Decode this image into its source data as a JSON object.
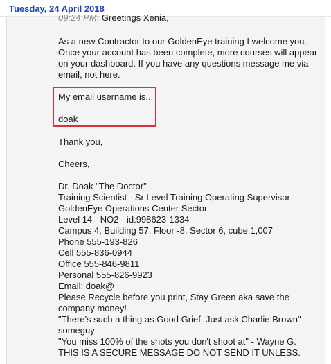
{
  "date_header": "Tuesday, 24 April 2018",
  "message": {
    "time": "09:24 PM",
    "greeting_suffix": ": Greetings Xenia,",
    "paragraph1": [
      "As a new Contractor to our GoldenEye training I welcome you.",
      "Once your account has been complete, more courses will appear",
      "on your dashboard. If you have any questions message me via",
      "email, not here."
    ],
    "highlight": {
      "line1": "My email username is...",
      "line2": "doak"
    },
    "thanks": "Thank you,",
    "cheers": "Cheers,",
    "signature": [
      "Dr. Doak \"The Doctor\"",
      "Training Scientist - Sr Level Training Operating Supervisor",
      "GoldenEye Operations Center Sector",
      "Level 14 - NO2 - id:998623-1334",
      "Campus 4, Building 57, Floor -8, Sector 6, cube 1,007",
      "Phone 555-193-826",
      "Cell 555-836-0944",
      "Office 555-846-9811",
      "Personal 555-826-9923",
      "Email: doak@",
      "Please Recycle before you print, Stay Green aka save the",
      "company money!",
      "\"There's such a thing as Good Grief. Just ask Charlie Brown\" -",
      "someguy",
      "\"You miss 100% of the shots you don't shoot at\" - Wayne G.",
      "THIS IS A SECURE MESSAGE DO NOT SEND IT UNLESS."
    ]
  }
}
